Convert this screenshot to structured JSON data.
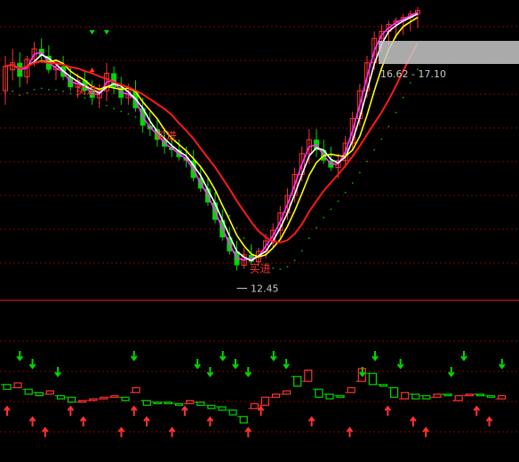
{
  "chart_data": {
    "type": "candlestick",
    "upper": {
      "candles": [
        {
          "o": 17.6,
          "h": 18.6,
          "l": 17.2,
          "c": 18.3
        },
        {
          "o": 18.2,
          "h": 18.8,
          "l": 17.9,
          "c": 18.4
        },
        {
          "o": 18.4,
          "h": 18.7,
          "l": 17.7,
          "c": 18.0
        },
        {
          "o": 18.0,
          "h": 18.6,
          "l": 17.8,
          "c": 18.5
        },
        {
          "o": 18.5,
          "h": 19.0,
          "l": 18.3,
          "c": 18.8
        },
        {
          "o": 18.8,
          "h": 19.1,
          "l": 18.4,
          "c": 18.6
        },
        {
          "o": 18.6,
          "h": 18.9,
          "l": 18.1,
          "c": 18.2
        },
        {
          "o": 18.2,
          "h": 18.5,
          "l": 17.9,
          "c": 18.3
        },
        {
          "o": 18.3,
          "h": 18.6,
          "l": 17.9,
          "c": 18.0
        },
        {
          "o": 18.0,
          "h": 18.3,
          "l": 17.6,
          "c": 17.7
        },
        {
          "o": 17.7,
          "h": 18.1,
          "l": 17.4,
          "c": 17.9
        },
        {
          "o": 17.9,
          "h": 18.2,
          "l": 17.5,
          "c": 17.6
        },
        {
          "o": 17.6,
          "h": 17.9,
          "l": 17.2,
          "c": 17.4
        },
        {
          "o": 17.4,
          "h": 17.8,
          "l": 17.1,
          "c": 17.6
        },
        {
          "o": 17.6,
          "h": 18.4,
          "l": 17.3,
          "c": 18.1
        },
        {
          "o": 18.1,
          "h": 18.3,
          "l": 17.5,
          "c": 17.7
        },
        {
          "o": 17.7,
          "h": 18.0,
          "l": 17.2,
          "c": 17.4
        },
        {
          "o": 17.4,
          "h": 17.8,
          "l": 17.2,
          "c": 17.6
        },
        {
          "o": 17.6,
          "h": 17.9,
          "l": 17.0,
          "c": 17.1
        },
        {
          "o": 17.1,
          "h": 17.4,
          "l": 16.4,
          "c": 16.6
        },
        {
          "o": 16.6,
          "h": 17.0,
          "l": 16.3,
          "c": 16.5
        },
        {
          "o": 16.5,
          "h": 16.8,
          "l": 16.0,
          "c": 16.2
        },
        {
          "o": 16.2,
          "h": 16.5,
          "l": 15.8,
          "c": 16.0
        },
        {
          "o": 16.0,
          "h": 16.3,
          "l": 15.7,
          "c": 15.9
        },
        {
          "o": 15.9,
          "h": 16.2,
          "l": 15.6,
          "c": 15.7
        },
        {
          "o": 15.7,
          "h": 16.0,
          "l": 15.4,
          "c": 15.6
        },
        {
          "o": 15.6,
          "h": 15.9,
          "l": 15.0,
          "c": 15.1
        },
        {
          "o": 15.1,
          "h": 15.4,
          "l": 14.7,
          "c": 14.8
        },
        {
          "o": 14.8,
          "h": 15.1,
          "l": 14.3,
          "c": 14.4
        },
        {
          "o": 14.4,
          "h": 14.7,
          "l": 13.8,
          "c": 13.9
        },
        {
          "o": 13.9,
          "h": 14.2,
          "l": 13.3,
          "c": 13.4
        },
        {
          "o": 13.4,
          "h": 13.7,
          "l": 12.9,
          "c": 13.0
        },
        {
          "o": 13.0,
          "h": 13.3,
          "l": 12.45,
          "c": 12.6
        },
        {
          "o": 12.6,
          "h": 13.1,
          "l": 12.5,
          "c": 12.9
        },
        {
          "o": 12.9,
          "h": 13.2,
          "l": 12.6,
          "c": 12.7
        },
        {
          "o": 12.7,
          "h": 13.1,
          "l": 12.6,
          "c": 13.0
        },
        {
          "o": 13.0,
          "h": 13.5,
          "l": 12.8,
          "c": 13.3
        },
        {
          "o": 13.3,
          "h": 13.8,
          "l": 13.1,
          "c": 13.6
        },
        {
          "o": 13.6,
          "h": 14.3,
          "l": 13.4,
          "c": 14.1
        },
        {
          "o": 14.1,
          "h": 14.8,
          "l": 13.9,
          "c": 14.6
        },
        {
          "o": 14.6,
          "h": 15.4,
          "l": 14.4,
          "c": 15.2
        },
        {
          "o": 15.2,
          "h": 16.0,
          "l": 15.0,
          "c": 15.8
        },
        {
          "o": 15.8,
          "h": 16.5,
          "l": 15.5,
          "c": 16.2
        },
        {
          "o": 16.2,
          "h": 16.5,
          "l": 15.7,
          "c": 15.9
        },
        {
          "o": 15.9,
          "h": 16.2,
          "l": 15.5,
          "c": 15.6
        },
        {
          "o": 15.6,
          "h": 16.0,
          "l": 15.3,
          "c": 15.4
        },
        {
          "o": 15.4,
          "h": 15.8,
          "l": 15.1,
          "c": 15.6
        },
        {
          "o": 15.6,
          "h": 16.3,
          "l": 15.4,
          "c": 16.1
        },
        {
          "o": 16.1,
          "h": 17.0,
          "l": 15.9,
          "c": 16.8
        },
        {
          "o": 16.8,
          "h": 17.8,
          "l": 16.6,
          "c": 17.6
        },
        {
          "o": 17.6,
          "h": 18.6,
          "l": 17.4,
          "c": 18.4
        },
        {
          "o": 18.4,
          "h": 19.3,
          "l": 18.2,
          "c": 19.1
        },
        {
          "o": 19.1,
          "h": 19.5,
          "l": 18.7,
          "c": 19.3
        },
        {
          "o": 19.3,
          "h": 19.6,
          "l": 18.9,
          "c": 19.5
        },
        {
          "o": 19.5,
          "h": 19.7,
          "l": 19.1,
          "c": 19.6
        },
        {
          "o": 19.6,
          "h": 19.8,
          "l": 19.2,
          "c": 19.7
        },
        {
          "o": 19.7,
          "h": 19.9,
          "l": 19.3,
          "c": 19.8
        },
        {
          "o": 19.8,
          "h": 20.0,
          "l": 19.4,
          "c": 19.9
        }
      ],
      "annotations": [
        {
          "text": "买进",
          "index": 9
        },
        {
          "text": "买进",
          "index": 20
        },
        {
          "text": "买进",
          "index": 33
        }
      ],
      "low_marker": {
        "text": "12.45",
        "value": 12.45,
        "index": 32
      },
      "price_range_label": "16.62 - 17.10",
      "down_triangles": [
        12,
        14
      ],
      "up_triangles": [
        12
      ]
    },
    "lower": {
      "boxes": [
        {
          "i": 0,
          "a": 0.4,
          "b": 0.1
        },
        {
          "i": 1,
          "a": 0.2,
          "b": 0.5
        },
        {
          "i": 2,
          "a": 0.1,
          "b": -0.2
        },
        {
          "i": 3,
          "a": -0.1,
          "b": -0.3
        },
        {
          "i": 4,
          "a": -0.2,
          "b": 0.0
        },
        {
          "i": 5,
          "a": -0.3,
          "b": -0.5
        },
        {
          "i": 6,
          "a": -0.4,
          "b": -0.7
        },
        {
          "i": 7,
          "a": -0.7,
          "b": -0.6
        },
        {
          "i": 8,
          "a": -0.6,
          "b": -0.5
        },
        {
          "i": 9,
          "a": -0.5,
          "b": -0.4
        },
        {
          "i": 10,
          "a": -0.4,
          "b": -0.3
        },
        {
          "i": 11,
          "a": -0.4,
          "b": -0.6
        },
        {
          "i": 12,
          "a": -0.1,
          "b": 0.2
        },
        {
          "i": 13,
          "a": -0.6,
          "b": -0.9
        },
        {
          "i": 14,
          "a": -0.7,
          "b": -0.8
        },
        {
          "i": 15,
          "a": -0.7,
          "b": -0.8
        },
        {
          "i": 16,
          "a": -0.8,
          "b": -0.9
        },
        {
          "i": 17,
          "a": -0.8,
          "b": -0.6
        },
        {
          "i": 18,
          "a": -0.7,
          "b": -0.9
        },
        {
          "i": 19,
          "a": -0.9,
          "b": -1.1
        },
        {
          "i": 20,
          "a": -1.0,
          "b": -1.2
        },
        {
          "i": 21,
          "a": -1.2,
          "b": -1.5
        },
        {
          "i": 22,
          "a": -1.6,
          "b": -2.0
        },
        {
          "i": 23,
          "a": -1.1,
          "b": -0.8
        },
        {
          "i": 24,
          "a": -0.9,
          "b": -0.4
        },
        {
          "i": 25,
          "a": -0.4,
          "b": -0.2
        },
        {
          "i": 26,
          "a": -0.2,
          "b": 0.0
        },
        {
          "i": 27,
          "a": 0.9,
          "b": 0.3
        },
        {
          "i": 28,
          "a": 0.6,
          "b": 1.3
        },
        {
          "i": 29,
          "a": 0.1,
          "b": -0.4
        },
        {
          "i": 30,
          "a": -0.2,
          "b": -0.5
        },
        {
          "i": 31,
          "a": -0.3,
          "b": -0.4
        },
        {
          "i": 32,
          "a": -0.1,
          "b": 0.2
        },
        {
          "i": 33,
          "a": 0.6,
          "b": 1.4
        },
        {
          "i": 34,
          "a": 1.1,
          "b": 0.4
        },
        {
          "i": 35,
          "a": 0.4,
          "b": 0.3
        },
        {
          "i": 36,
          "a": 0.2,
          "b": -0.4
        },
        {
          "i": 37,
          "a": -0.5,
          "b": -0.1
        },
        {
          "i": 38,
          "a": -0.2,
          "b": -0.5
        },
        {
          "i": 39,
          "a": -0.3,
          "b": -0.5
        },
        {
          "i": 40,
          "a": -0.4,
          "b": -0.2
        },
        {
          "i": 41,
          "a": -0.2,
          "b": -0.3
        },
        {
          "i": 42,
          "a": -0.6,
          "b": -0.3
        },
        {
          "i": 43,
          "a": -0.3,
          "b": -0.2
        },
        {
          "i": 44,
          "a": -0.2,
          "b": -0.3
        },
        {
          "i": 45,
          "a": -0.3,
          "b": -0.4
        },
        {
          "i": 46,
          "a": -0.5,
          "b": -0.3
        }
      ],
      "down_arrows": [
        1,
        2,
        4,
        10,
        15,
        16,
        17,
        18,
        19,
        21,
        22,
        28,
        29,
        31,
        35,
        36,
        39,
        41,
        43,
        45
      ],
      "up_arrows": [
        0,
        2,
        3,
        5,
        6,
        9,
        10,
        11,
        13,
        14,
        16,
        19,
        20,
        24,
        27,
        30,
        32,
        33,
        37,
        38,
        42,
        44,
        46
      ]
    },
    "colors": {
      "up": "#ff3232",
      "down": "#00d800",
      "cyan": "#4ad8ff",
      "ma_white": "#ffffff",
      "ma_yellow": "#ffff00",
      "ma_magenta": "#ff33ff",
      "ma_red": "#ff1a1a",
      "grid": "#8b0000",
      "dots": "#00b400"
    }
  }
}
